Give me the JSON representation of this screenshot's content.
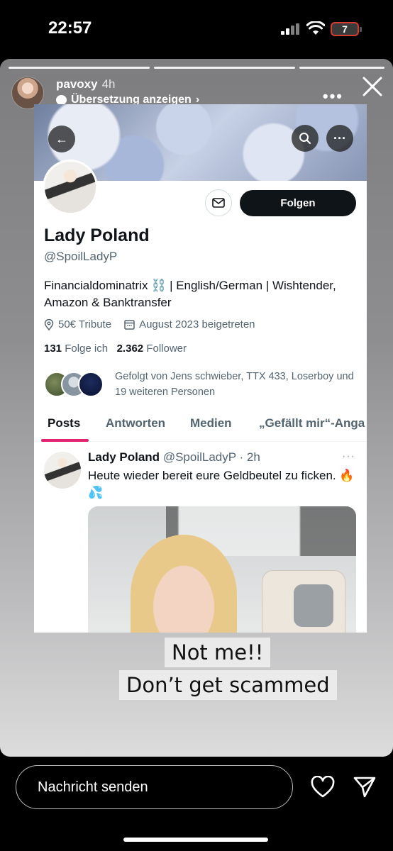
{
  "status_bar": {
    "time": "22:57",
    "battery": "7"
  },
  "story": {
    "username": "pavoxy",
    "time_ago": "4h",
    "translate_label": "Übersetzung anzeigen",
    "captions": [
      "Not me!!",
      "Don’t get scammed"
    ]
  },
  "profile": {
    "name": "Lady Poland",
    "handle": "@SpoilLadyP",
    "follow_label": "Folgen",
    "bio": "Financialdominatrix ⛓️ | English/German | Wishtender, Amazon & Banktransfer",
    "location": "50€ Tribute",
    "joined": "August 2023 beigetreten",
    "following_count": "131",
    "following_label": "Folge ich",
    "followers_count": "2.362",
    "followers_label": "Follower",
    "followed_by": "Gefolgt von Jens schwieber, TTX 433, Loserboy und 19 weiteren Personen"
  },
  "tabs": [
    {
      "label": "Posts"
    },
    {
      "label": "Antworten"
    },
    {
      "label": "Medien"
    },
    {
      "label": "„Gefällt mir“-Anga"
    }
  ],
  "tweet": {
    "name": "Lady Poland",
    "handle_time": "@SpoilLadyP · 2h",
    "text": "Heute wieder bereit eure Geldbeutel zu ficken. 🔥💦"
  },
  "bottom_bar": {
    "message_placeholder": "Nachricht senden"
  },
  "colors": {
    "accent_tab": "#e0246f",
    "follow_button": "#0f1419",
    "text_secondary": "#536471"
  }
}
